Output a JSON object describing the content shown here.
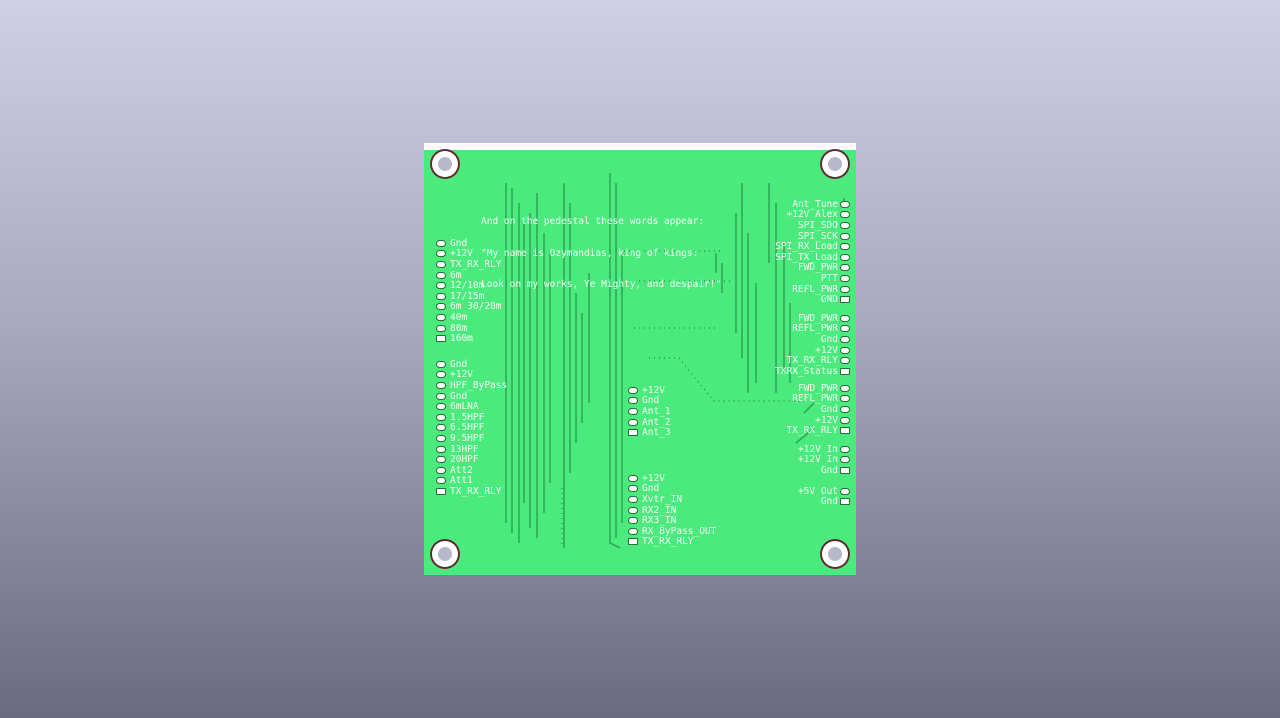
{
  "pedestal_text": [
    "And on the pedestal these words appear:",
    "\"My name is Ozymandias, king of kings:",
    "Look on my works, Ye Mighty, and despair!\""
  ],
  "headers": {
    "left_a": [
      "Gnd",
      "+12V",
      "TX_RX_RLY",
      "6m",
      "12/10m",
      "17/15m",
      "6m 30/20m",
      "40m",
      "80m",
      "160m"
    ],
    "left_b": [
      "Gnd",
      "+12V",
      "HPF_ByPass",
      "Gnd",
      "6mLNA",
      "1.5HPF",
      "6.5HPF",
      "9.5HPF",
      "13HPF",
      "20HPF",
      "Att2",
      "Att1",
      "TX_RX_RLY"
    ],
    "mid_a": [
      "+12V",
      "Gnd",
      "Ant_1",
      "Ant_2",
      "Ant_3"
    ],
    "mid_b": [
      "+12V",
      "Gnd",
      "Xvtr_IN",
      "RX2_IN",
      "RX3_IN",
      "RX_ByPass_OUT",
      "TX_RX_RLY"
    ],
    "right_a": [
      "Ant_Tune",
      "+12V Alex",
      "SPI_SDO",
      "SPI_SCK",
      "SPI_RX_Load",
      "SPI_TX_Load",
      "FWD_PWR",
      "PTT",
      "REFL_PWR",
      "GND"
    ],
    "right_b": [
      "FWD_PWR",
      "REFL_PWR",
      "Gnd",
      "+12V",
      "TX_RX_RLY",
      "TXRX_Status"
    ],
    "right_c": [
      "FWD_PWR",
      "REFL_PWR",
      "Gnd",
      "+12V",
      "TX_RX_RLY"
    ],
    "right_d": [
      "+12V In",
      "+12V In",
      "Gnd"
    ],
    "right_e": [
      "+5V Out",
      "Gnd"
    ]
  },
  "colors": {
    "background_top": "#cfcfe6",
    "background_bottom": "#6a6a82",
    "board": "#4aeb7c",
    "trace": "#2fa85a",
    "silkscreen": "#f4fff6"
  }
}
